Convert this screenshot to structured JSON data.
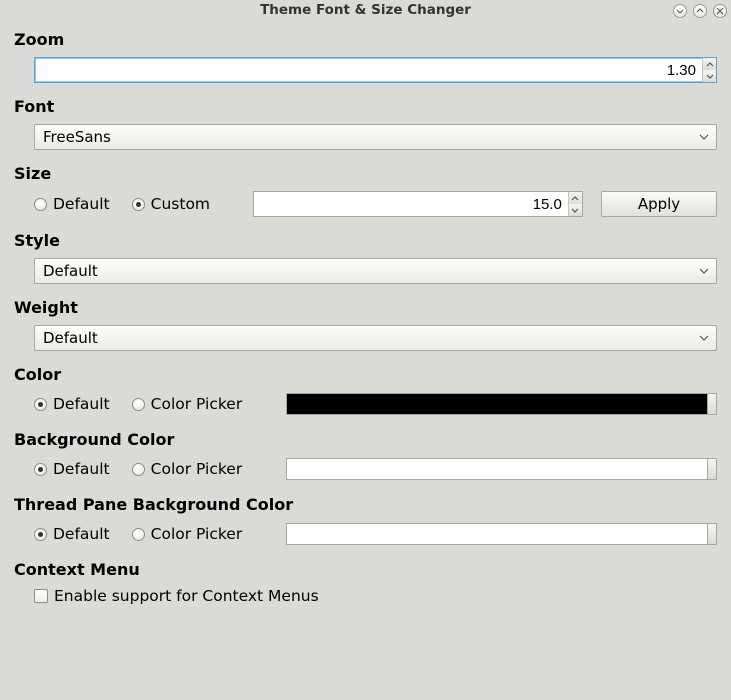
{
  "title": "Theme Font & Size Changer",
  "sections": {
    "zoom": {
      "label": "Zoom",
      "value": "1.30"
    },
    "font": {
      "label": "Font",
      "value": "FreeSans"
    },
    "size": {
      "label": "Size",
      "default_label": "Default",
      "custom_label": "Custom",
      "selected": "custom",
      "value": "15.0",
      "apply_label": "Apply"
    },
    "style": {
      "label": "Style",
      "value": "Default"
    },
    "weight": {
      "label": "Weight",
      "value": "Default"
    },
    "color": {
      "label": "Color",
      "default_label": "Default",
      "picker_label": "Color Picker",
      "selected": "default",
      "swatch": "#000000"
    },
    "bg": {
      "label": "Background Color",
      "default_label": "Default",
      "picker_label": "Color Picker",
      "selected": "default",
      "swatch": "#ffffff"
    },
    "thread_bg": {
      "label": "Thread Pane Background Color",
      "default_label": "Default",
      "picker_label": "Color Picker",
      "selected": "default",
      "swatch": "#ffffff"
    },
    "context_menu": {
      "label": "Context Menu",
      "checkbox_label": "Enable support for Context Menus",
      "checked": false
    }
  }
}
